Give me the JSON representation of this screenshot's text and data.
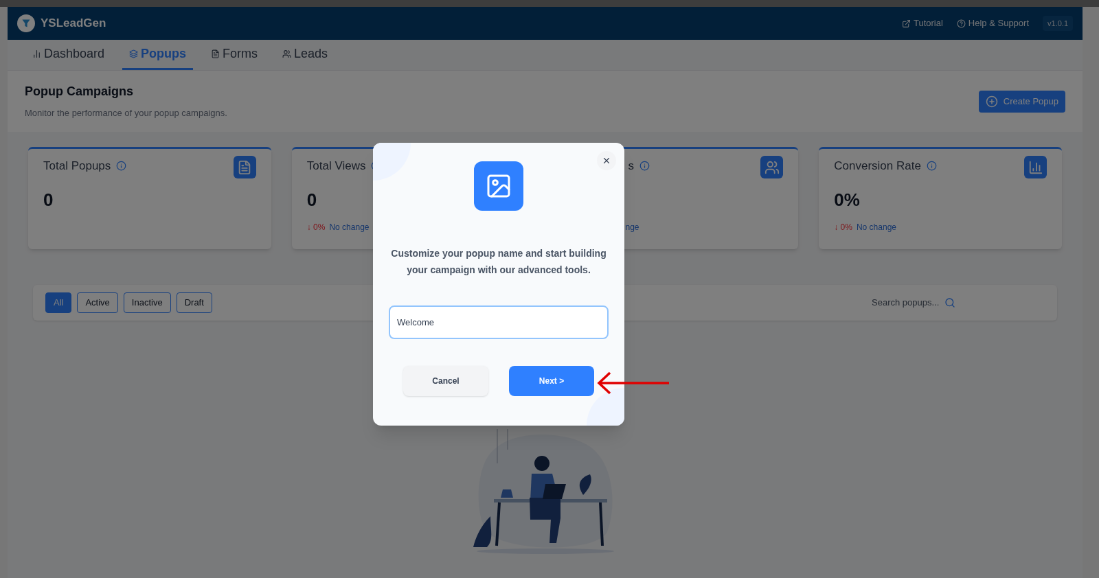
{
  "app": {
    "name": "YSLeadGen"
  },
  "header_links": [
    {
      "label": "Tutorial"
    },
    {
      "label": "Help & Support"
    }
  ],
  "version": "v1.0.1",
  "tabs": [
    {
      "label": "Dashboard",
      "selected": false
    },
    {
      "label": "Popups",
      "selected": true
    },
    {
      "label": "Forms",
      "selected": false
    },
    {
      "label": "Leads",
      "selected": false
    }
  ],
  "page": {
    "title": "Popup Campaigns",
    "subtitle": "Monitor the performance of your popup campaigns.",
    "create_button": "Create Popup"
  },
  "stats": [
    {
      "title": "Total Popups",
      "value": "0"
    },
    {
      "title": "Total Views",
      "value": "0",
      "change": "↓ 0%",
      "change_note": "No change"
    },
    {
      "title": "s",
      "change_note": "nge",
      "partly_hidden": true
    },
    {
      "title": "Conversion Rate",
      "value": "0%",
      "change": "↓ 0%",
      "change_note": "No change"
    }
  ],
  "filters": [
    {
      "label": "All",
      "selected": true
    },
    {
      "label": "Active",
      "selected": false
    },
    {
      "label": "Inactive",
      "selected": false
    },
    {
      "label": "Draft",
      "selected": false
    }
  ],
  "search": {
    "placeholder": "Search popups..."
  },
  "dialog": {
    "message": "Customize your popup name and start building your campaign with our advanced tools.",
    "input": {
      "value": "Welcome"
    },
    "buttons": [
      {
        "label": "Cancel",
        "kind": "secondary"
      },
      {
        "label": "Next >",
        "kind": "primary"
      }
    ]
  }
}
